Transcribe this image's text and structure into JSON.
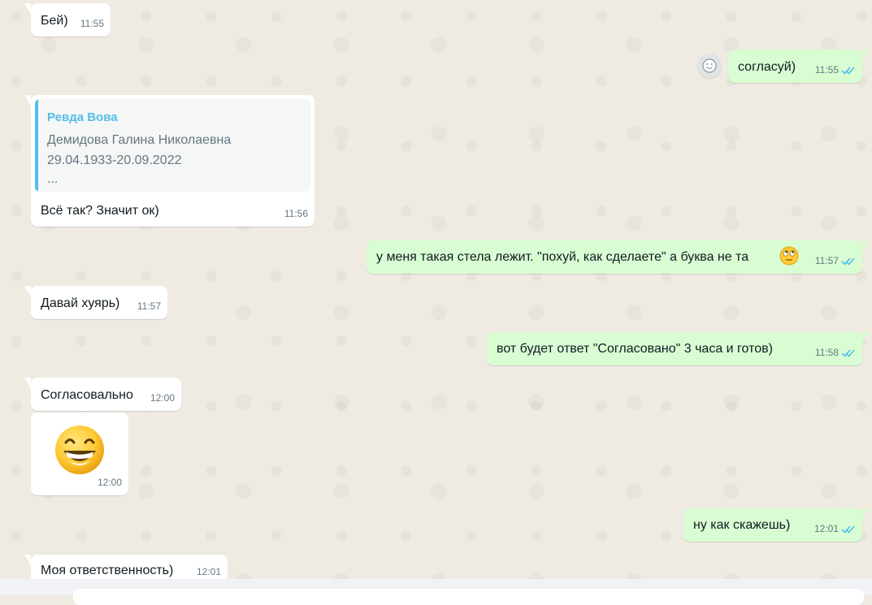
{
  "messages": [
    {
      "text": "Бей)",
      "time": "11:55"
    },
    {
      "text": "согласуй)",
      "time": "11:55"
    },
    {
      "quote": {
        "author": "Ревда Вова",
        "lines": [
          "Демидова Галина Николаевна",
          "29.04.1933-20.09.2022",
          "..."
        ]
      },
      "text": "Всё так? Значит ок)",
      "time": "11:56"
    },
    {
      "text": "у меня такая стела лежит. \"похуй, как сделаете\" а буква не та",
      "time": "11:57"
    },
    {
      "text": "Давай хуярь)",
      "time": "11:57"
    },
    {
      "text": "вот будет ответ \"Согласовано\" 3 часа и готов)",
      "time": "11:58"
    },
    {
      "text": "Согласовально",
      "time": "12:00"
    },
    {
      "sticker": "grinning-face-emoji",
      "time": "12:00"
    },
    {
      "text": "ну как скажешь)",
      "time": "12:01"
    },
    {
      "text": "Моя ответственность)",
      "time": "12:01"
    }
  ],
  "colors": {
    "background": "#efeae2",
    "incoming": "#ffffff",
    "outgoing": "#d9fdd3",
    "quote_accent": "#53bdeb",
    "read_ticks": "#53bdeb",
    "meta_text": "#667781"
  },
  "icons": {
    "read_status": "double-check-icon",
    "reaction_avatar": "smiley-reaction-icon",
    "inline_emoji": "rolling-eyes-emoji"
  }
}
